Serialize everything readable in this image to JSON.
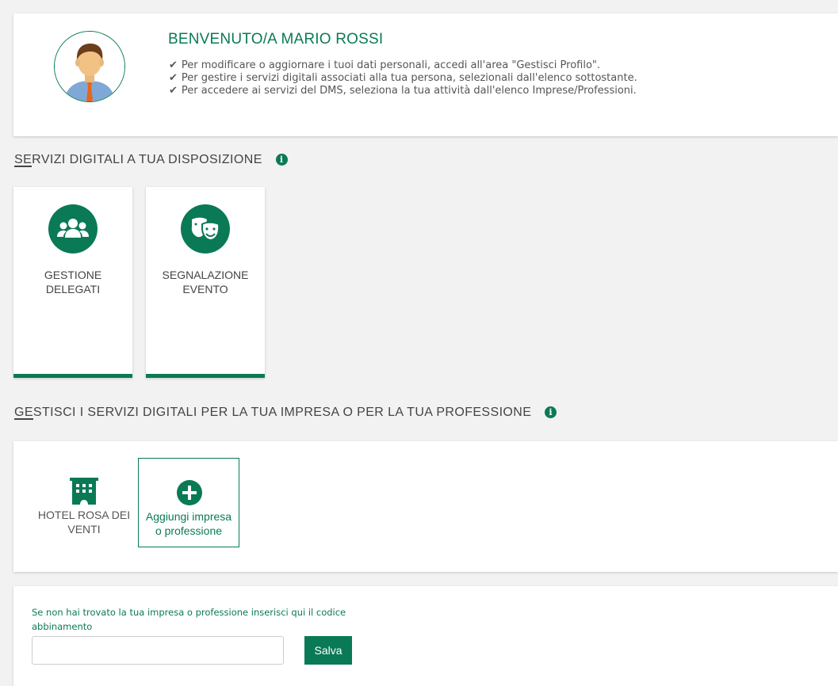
{
  "welcome": {
    "title": "BENVENUTO/A MARIO ROSSI",
    "bullets": [
      "Per modificare o aggiornare i tuoi dati personali, accedi all'area \"Gestisci Profilo\".",
      "Per gestire i servizi digitali associati alla tua persona, selezionali dall'elenco sottostante.",
      "Per accedere ai servizi del DMS, seleziona la tua attività dall'elenco Imprese/Professioni."
    ]
  },
  "servizi": {
    "title_first": "SE",
    "title_rest": "RVIZI DIGITALI A TUA DISPOSIZIONE",
    "info_glyph": "i",
    "tiles": [
      {
        "label": "GESTIONE DELEGATI",
        "icon": "users-icon"
      },
      {
        "label": "SEGNALAZIONE EVENTO",
        "icon": "theater-masks-icon"
      }
    ]
  },
  "impresa": {
    "title_first": "GE",
    "title_rest": "STISCI I SERVIZI DIGITALI PER LA TUA IMPRESA O PER LA TUA PROFESSIONE",
    "info_glyph": "i",
    "hotel_label": "HOTEL ROSA DEI VENTI",
    "hotel_icon": "building-icon",
    "add_label": "Aggiungi impresa o professione",
    "add_icon": "plus-circle-icon"
  },
  "abbinamento": {
    "label": "Se non hai trovato la tua impresa o professione inserisci qui il codice abbinamento",
    "input_value": "",
    "save_label": "Salva"
  },
  "colors": {
    "accent": "#0a7a56",
    "background": "#f2f2f2"
  }
}
